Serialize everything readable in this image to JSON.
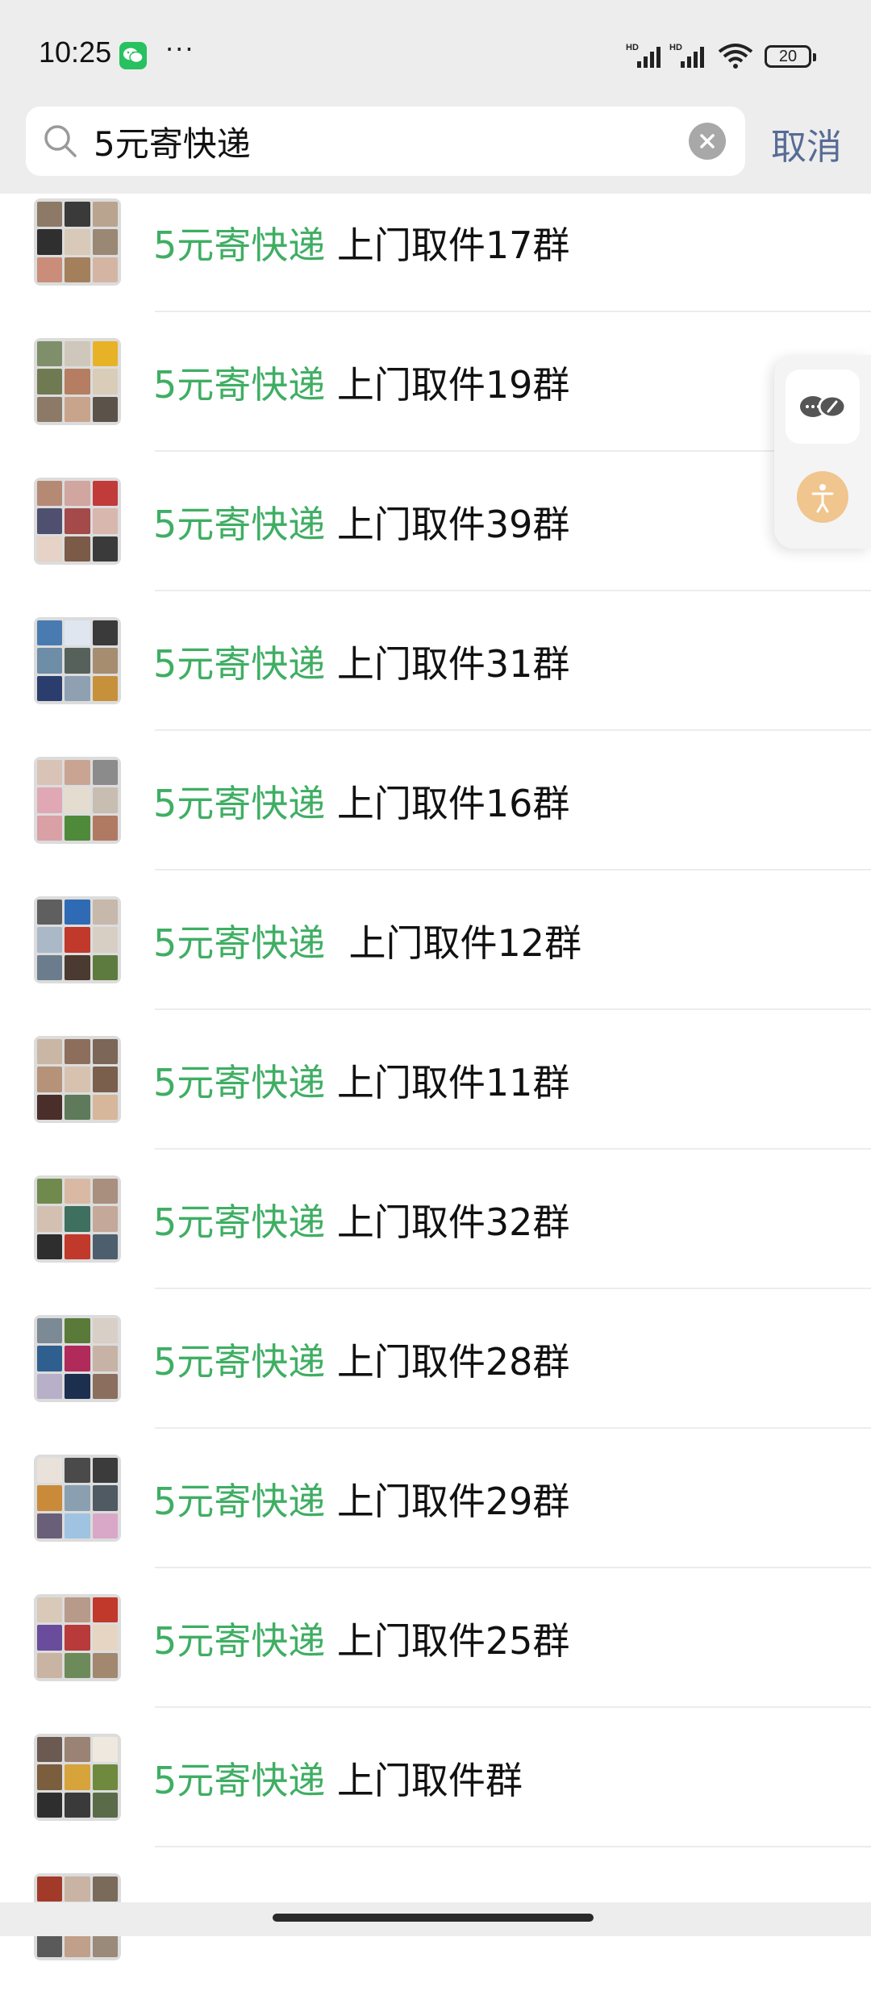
{
  "status_bar": {
    "time": "10:25",
    "more_dots": "···",
    "battery": "20",
    "icons": [
      "wechat-icon",
      "signal-hd-icon",
      "signal-hd-icon",
      "wifi-icon",
      "battery-icon"
    ]
  },
  "search": {
    "value": "5元寄快递",
    "cancel_label": "取消",
    "icons": [
      "search-icon",
      "clear-icon"
    ]
  },
  "results": [
    {
      "highlight": "5元寄快递",
      "rest": " 上门取件17群"
    },
    {
      "highlight": "5元寄快递",
      "rest": " 上门取件19群"
    },
    {
      "highlight": "5元寄快递",
      "rest": " 上门取件39群"
    },
    {
      "highlight": "5元寄快递",
      "rest": " 上门取件31群"
    },
    {
      "highlight": "5元寄快递",
      "rest": " 上门取件16群"
    },
    {
      "highlight": "5元寄快递",
      "rest": "  上门取件12群"
    },
    {
      "highlight": "5元寄快递",
      "rest": " 上门取件11群"
    },
    {
      "highlight": "5元寄快递",
      "rest": " 上门取件32群"
    },
    {
      "highlight": "5元寄快递",
      "rest": " 上门取件28群"
    },
    {
      "highlight": "5元寄快递",
      "rest": " 上门取件29群"
    },
    {
      "highlight": "5元寄快递",
      "rest": " 上门取件25群"
    },
    {
      "highlight": "5元寄快递",
      "rest": " 上门取件群"
    }
  ],
  "floating_widget": {
    "icons": [
      "chat-bubbles-icon",
      "accessibility-icon"
    ]
  },
  "colors": {
    "highlight": "#3fae63",
    "cancel": "#576b95",
    "header_bg": "#ededed"
  }
}
